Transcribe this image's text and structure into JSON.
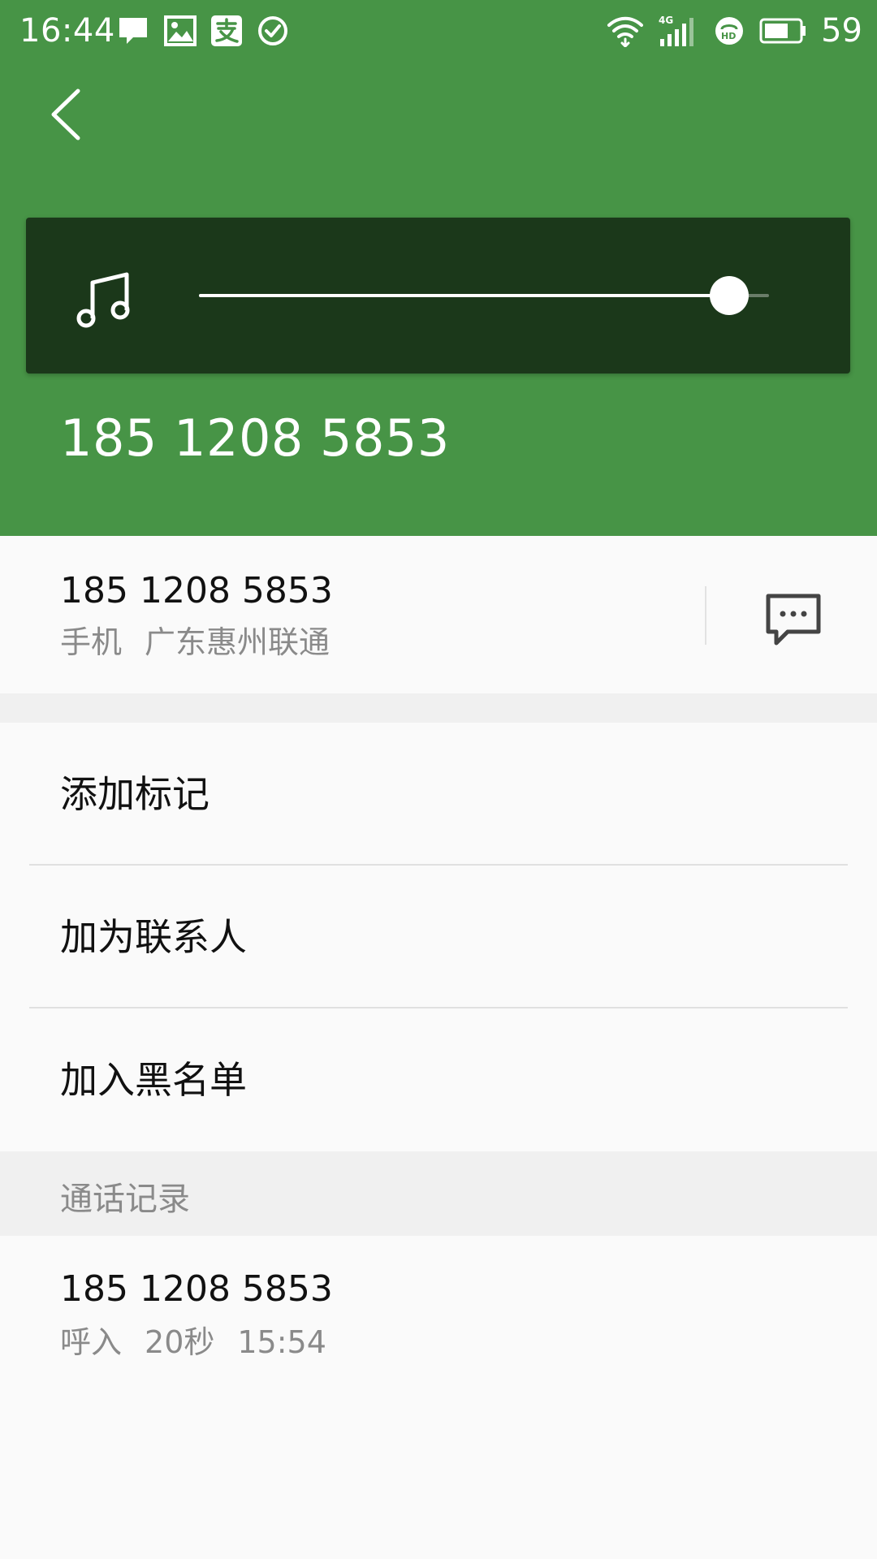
{
  "status_bar": {
    "time": "16:44",
    "battery_level": "59",
    "left_icons": [
      "message-notification-icon",
      "image-notification-icon",
      "alipay-notification-icon",
      "check-circle-icon"
    ],
    "right_icons": [
      "wifi-icon",
      "signal-4g-icon",
      "hd-voice-icon",
      "battery-icon"
    ]
  },
  "header": {
    "background_color": "#479446",
    "phone_number": "185 1208 5853",
    "back_icon": "back-arrow-icon"
  },
  "ringtone": {
    "icon": "music-note-icon",
    "volume": 0.93,
    "panel_color": "#1b381a"
  },
  "number_info": {
    "number": "185 1208 5853",
    "type": "手机",
    "location": "广东惠州联通",
    "message_icon": "message-icon"
  },
  "menu": {
    "items": [
      {
        "label": "添加标记"
      },
      {
        "label": "加为联系人"
      },
      {
        "label": "加入黑名单"
      }
    ]
  },
  "call_log": {
    "header": "通话记录",
    "entries": [
      {
        "number": "185 1208 5853",
        "direction": "呼入",
        "duration": "20秒",
        "time": "15:54"
      }
    ]
  }
}
